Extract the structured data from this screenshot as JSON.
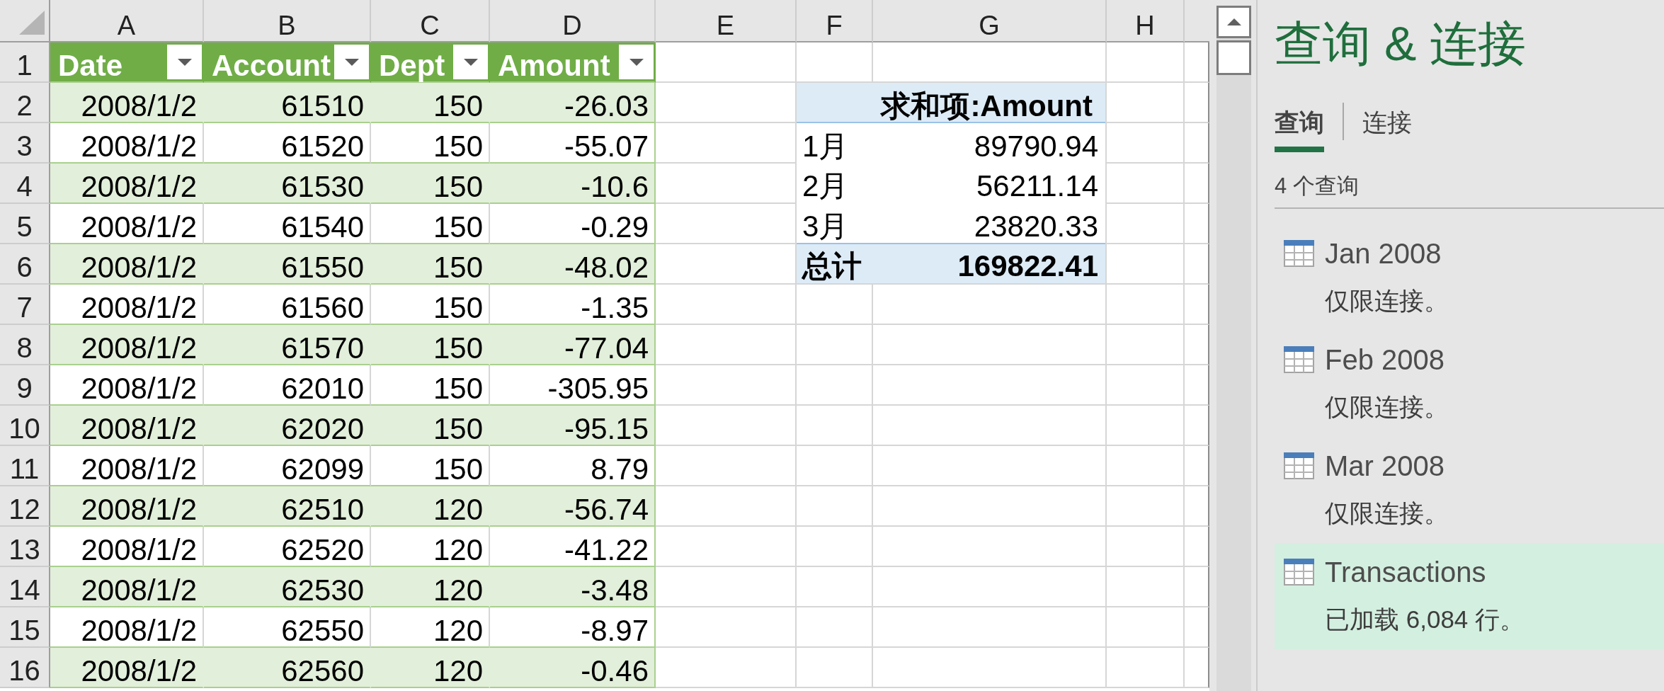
{
  "sheet": {
    "column_headers": [
      "A",
      "B",
      "C",
      "D",
      "E",
      "F",
      "G",
      "H"
    ],
    "row_headers": [
      "1",
      "2",
      "3",
      "4",
      "5",
      "6",
      "7",
      "8",
      "9",
      "10",
      "11",
      "12",
      "13",
      "14",
      "15",
      "16"
    ],
    "table": {
      "columns": [
        "Date",
        "Account",
        "Dept",
        "Amount"
      ],
      "rows": [
        [
          "2008/1/2",
          "61510",
          "150",
          "-26.03"
        ],
        [
          "2008/1/2",
          "61520",
          "150",
          "-55.07"
        ],
        [
          "2008/1/2",
          "61530",
          "150",
          "-10.6"
        ],
        [
          "2008/1/2",
          "61540",
          "150",
          "-0.29"
        ],
        [
          "2008/1/2",
          "61550",
          "150",
          "-48.02"
        ],
        [
          "2008/1/2",
          "61560",
          "150",
          "-1.35"
        ],
        [
          "2008/1/2",
          "61570",
          "150",
          "-77.04"
        ],
        [
          "2008/1/2",
          "62010",
          "150",
          "-305.95"
        ],
        [
          "2008/1/2",
          "62020",
          "150",
          "-95.15"
        ],
        [
          "2008/1/2",
          "62099",
          "150",
          "8.79"
        ],
        [
          "2008/1/2",
          "62510",
          "120",
          "-56.74"
        ],
        [
          "2008/1/2",
          "62520",
          "120",
          "-41.22"
        ],
        [
          "2008/1/2",
          "62530",
          "120",
          "-3.48"
        ],
        [
          "2008/1/2",
          "62550",
          "120",
          "-8.97"
        ],
        [
          "2008/1/2",
          "62560",
          "120",
          "-0.46"
        ]
      ]
    },
    "pivot": {
      "header": "求和项:Amount",
      "rows": [
        {
          "label": "1月",
          "value": "89790.94"
        },
        {
          "label": "2月",
          "value": "56211.14"
        },
        {
          "label": "3月",
          "value": "23820.33"
        }
      ],
      "total": {
        "label": "总计",
        "value": "169822.41"
      }
    }
  },
  "panel": {
    "title": "查询 & 连接",
    "tabs": [
      {
        "label": "查询",
        "selected": true
      },
      {
        "label": "连接",
        "selected": false
      }
    ],
    "count": "4 个查询",
    "queries": [
      {
        "name": "Jan 2008",
        "status": "仅限连接。",
        "selected": false
      },
      {
        "name": "Feb 2008",
        "status": "仅限连接。",
        "selected": false
      },
      {
        "name": "Mar 2008",
        "status": "仅限连接。",
        "selected": false
      },
      {
        "name": "Transactions",
        "status": "已加载 6,084 行。",
        "selected": true
      }
    ]
  }
}
